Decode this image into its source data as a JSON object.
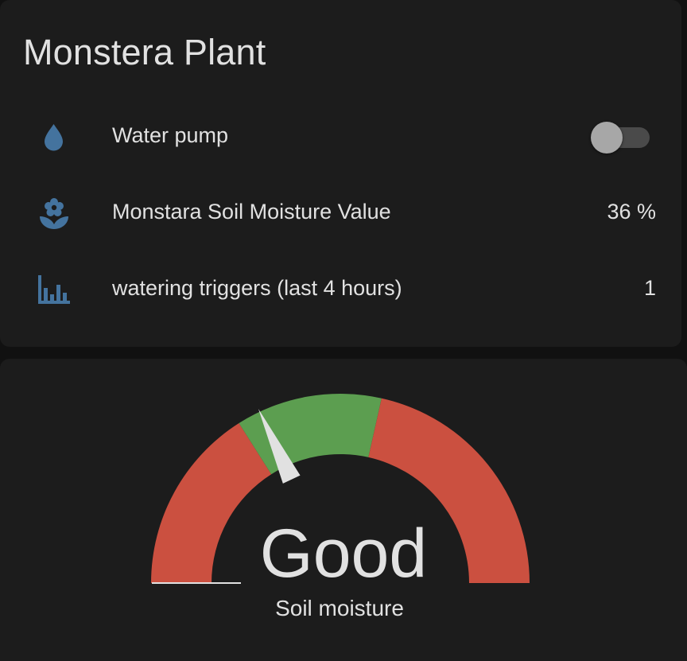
{
  "colors": {
    "icon": "#44739e",
    "gauge_red": "#cb5040",
    "gauge_green": "#5c9e50",
    "needle": "#e1e1e1"
  },
  "entities_card": {
    "title": "Monstera Plant",
    "rows": [
      {
        "icon": "water-drop-icon",
        "label": "Water pump",
        "control": "toggle",
        "toggle_on": false
      },
      {
        "icon": "flower-icon",
        "label": "Monstara Soil Moisture Value",
        "value": "36 %"
      },
      {
        "icon": "bar-chart-icon",
        "label": "watering triggers (last 4 hours)",
        "value": "1"
      }
    ]
  },
  "gauge_card": {
    "value_label": "Good",
    "name": "Soil moisture",
    "needle_fraction": 0.36,
    "segments": [
      {
        "from": 0.0,
        "to": 0.32,
        "color": "#cb5040"
      },
      {
        "from": 0.32,
        "to": 0.57,
        "color": "#5c9e50"
      },
      {
        "from": 0.57,
        "to": 1.0,
        "color": "#cb5040"
      }
    ]
  }
}
